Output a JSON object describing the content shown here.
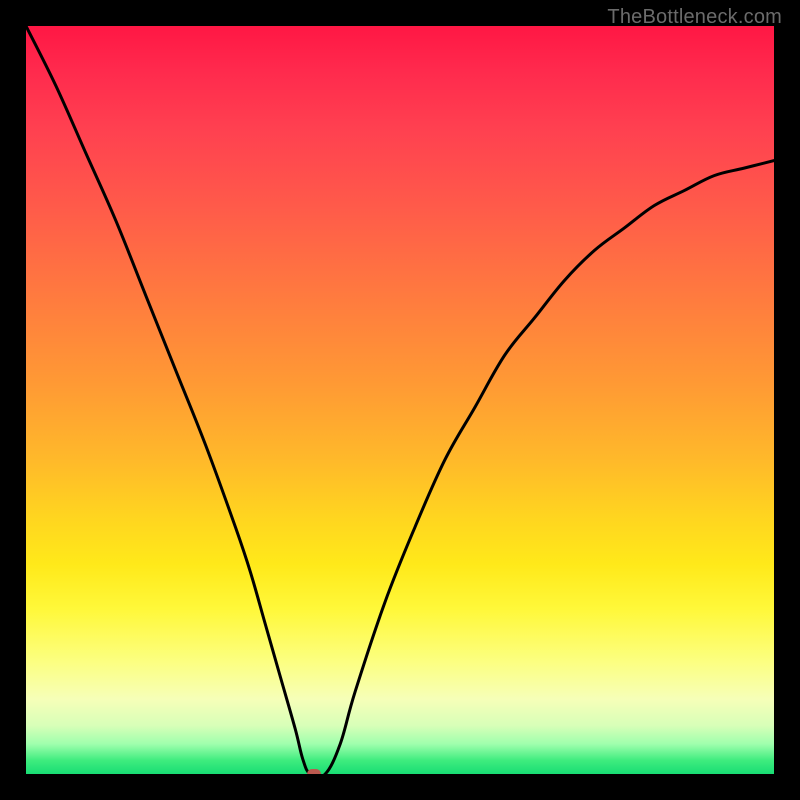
{
  "watermark": "TheBottleneck.com",
  "chart_data": {
    "type": "line",
    "title": "",
    "xlabel": "",
    "ylabel": "",
    "xlim": [
      0,
      100
    ],
    "ylim": [
      0,
      100
    ],
    "grid": false,
    "legend": false,
    "series": [
      {
        "name": "bottleneck-curve",
        "x": [
          0,
          4,
          8,
          12,
          16,
          20,
          24,
          28,
          30,
          32,
          34,
          36,
          37,
          38,
          40,
          42,
          44,
          48,
          52,
          56,
          60,
          64,
          68,
          72,
          76,
          80,
          84,
          88,
          92,
          96,
          100
        ],
        "values": [
          100,
          92,
          83,
          74,
          64,
          54,
          44,
          33,
          27,
          20,
          13,
          6,
          2,
          0,
          0,
          4,
          11,
          23,
          33,
          42,
          49,
          56,
          61,
          66,
          70,
          73,
          76,
          78,
          80,
          81,
          82
        ]
      }
    ],
    "marker": {
      "x": 38.5,
      "y": 0,
      "color": "#bb594f"
    },
    "gradient_stops": [
      {
        "pos": 0.0,
        "color": "#ff1744"
      },
      {
        "pos": 0.48,
        "color": "#ff9a34"
      },
      {
        "pos": 0.72,
        "color": "#ffe91a"
      },
      {
        "pos": 0.9,
        "color": "#f6ffb8"
      },
      {
        "pos": 1.0,
        "color": "#18dd74"
      }
    ],
    "colors": {
      "frame": "#000000",
      "curve": "#000000",
      "watermark": "#6b6b6b"
    }
  }
}
